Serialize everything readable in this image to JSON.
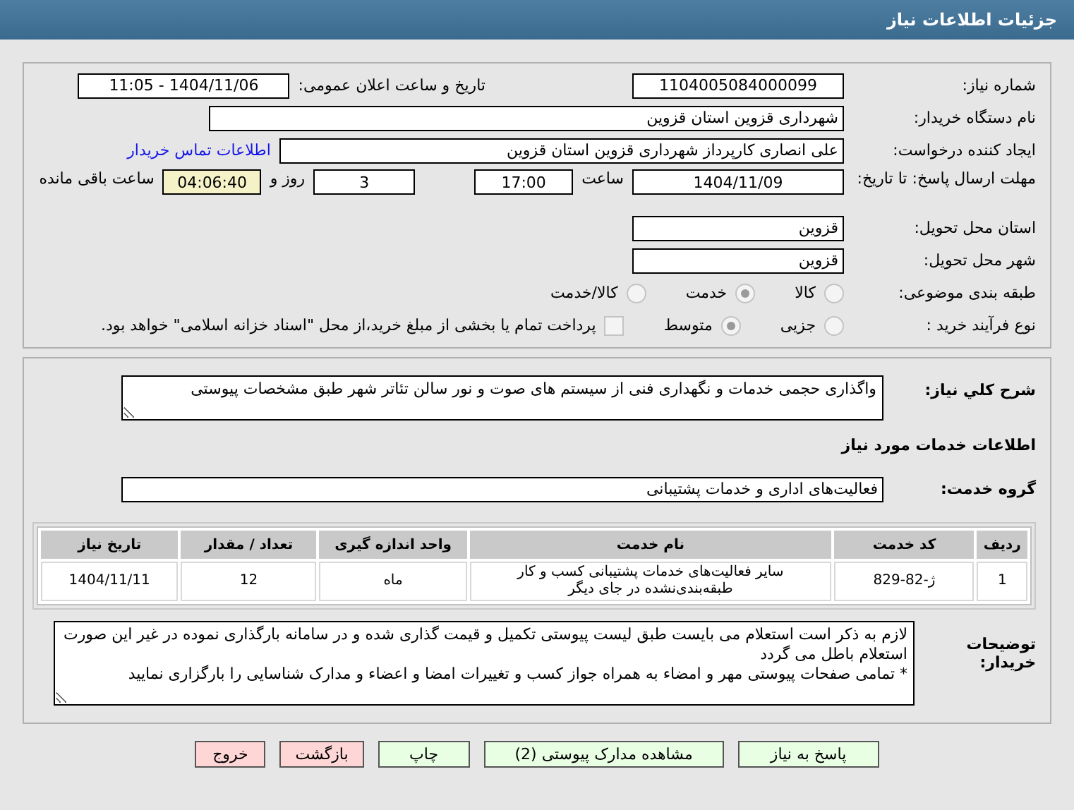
{
  "header": {
    "title": "جزئیات اطلاعات نیاز"
  },
  "need_number": {
    "label": "شماره نیاز:",
    "value": "1104005084000099"
  },
  "announce": {
    "label": "تاریخ و ساعت اعلان عمومی:",
    "value": "1404/11/06 - 11:05"
  },
  "buyer": {
    "label": "نام دستگاه خریدار:",
    "value": "شهرداری قزوین استان قزوین"
  },
  "creator": {
    "label": "ایجاد کننده درخواست:",
    "value": "علی انصاری کارپرداز شهرداری قزوین استان قزوین",
    "link": "اطلاعات تماس خریدار"
  },
  "deadline": {
    "label": "مهلت ارسال پاسخ: تا تاریخ:",
    "date": "1404/11/09",
    "time_label": "ساعت",
    "time": "17:00",
    "days": "3",
    "days_label": "روز و",
    "remaining": "04:06:40",
    "remaining_label": "ساعت باقی مانده"
  },
  "province": {
    "label": "استان محل تحویل:",
    "value": "قزوین"
  },
  "city": {
    "label": "شهر محل تحویل:",
    "value": "قزوین"
  },
  "category": {
    "label": "طبقه بندی موضوعی:",
    "options": [
      {
        "label": "کالا",
        "selected": false
      },
      {
        "label": "خدمت",
        "selected": true
      },
      {
        "label": "کالا/خدمت",
        "selected": false
      }
    ]
  },
  "process": {
    "label": "نوع فرآیند خرید :",
    "options": [
      {
        "label": "جزیی",
        "selected": false
      },
      {
        "label": "متوسط",
        "selected": true
      }
    ],
    "payment": {
      "checked": false,
      "text": "پرداخت تمام یا بخشی از مبلغ خرید،از محل \"اسناد خزانه اسلامی\" خواهد بود."
    }
  },
  "description": {
    "label": "شرح کلي نیاز:",
    "value": "واگذاری حجمی خدمات و نگهداری فنی از سیستم های صوت و نور سالن تئاتر شهر طبق مشخصات پیوستی"
  },
  "services_title": "اطلاعات خدمات مورد نیاز",
  "service_group": {
    "label": "گروه خدمت:",
    "value": "فعالیت‌های اداری و خدمات پشتیبانی"
  },
  "table": {
    "columns": [
      "ردیف",
      "کد خدمت",
      "نام خدمت",
      "واحد اندازه گیری",
      "تعداد / مقدار",
      "تاریخ نیاز"
    ],
    "rows": [
      [
        "1",
        "ژ-82-829",
        "سایر فعالیت‌های خدمات پشتیبانی کسب و کار طبقه‌بندی‌نشده در جای دیگر",
        "ماه",
        "12",
        "1404/11/11"
      ]
    ]
  },
  "notes": {
    "label": "توضیحات خریدار:",
    "value": "لازم به ذکر است استعلام می بایست طبق لیست پیوستی تکمیل و قیمت گذاری شده و در سامانه بارگذاری نموده در غیر این صورت استعلام باطل می گردد\n* تمامی صفحات پیوستی مهر و امضاء به همراه جواز کسب و تغییرات امضا و اعضاء و مدارک شناسایی را بارگزاری نمایید"
  },
  "buttons": [
    {
      "label": "پاسخ به نیاز",
      "kind": "go"
    },
    {
      "label": "مشاهده مدارک پیوستی (2)",
      "kind": "go"
    },
    {
      "label": "چاپ",
      "kind": "go"
    },
    {
      "label": "بازگشت",
      "kind": "stop"
    },
    {
      "label": "خروج",
      "kind": "stop"
    }
  ]
}
